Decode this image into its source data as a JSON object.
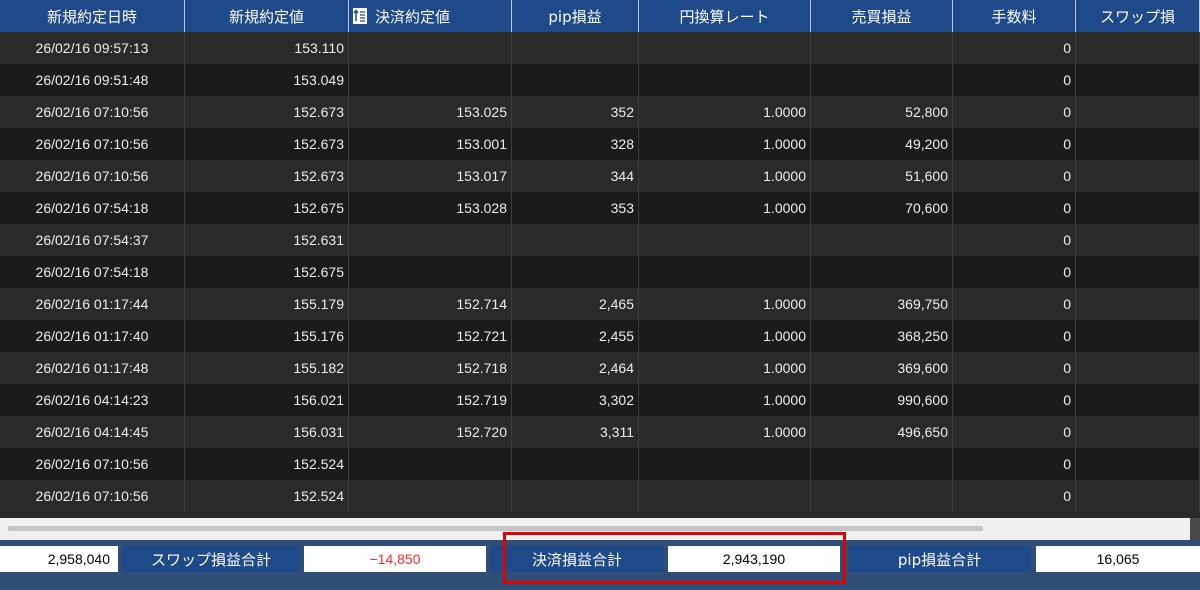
{
  "columns": [
    "新規約定日時",
    "新規約定値",
    "決済約定値",
    "pip損益",
    "円換算レート",
    "売買損益",
    "手数料",
    "スワップ損"
  ],
  "rows": [
    [
      "26/02/16 09:57:13",
      "153.110",
      "",
      "",
      "",
      "",
      "0",
      ""
    ],
    [
      "26/02/16 09:51:48",
      "153.049",
      "",
      "",
      "",
      "",
      "0",
      ""
    ],
    [
      "26/02/16 07:10:56",
      "152.673",
      "153.025",
      "352",
      "1.0000",
      "52,800",
      "0",
      ""
    ],
    [
      "26/02/16 07:10:56",
      "152.673",
      "153.001",
      "328",
      "1.0000",
      "49,200",
      "0",
      ""
    ],
    [
      "26/02/16 07:10:56",
      "152.673",
      "153.017",
      "344",
      "1.0000",
      "51,600",
      "0",
      ""
    ],
    [
      "26/02/16 07:54:18",
      "152.675",
      "153.028",
      "353",
      "1.0000",
      "70,600",
      "0",
      ""
    ],
    [
      "26/02/16 07:54:37",
      "152.631",
      "",
      "",
      "",
      "",
      "0",
      ""
    ],
    [
      "26/02/16 07:54:18",
      "152.675",
      "",
      "",
      "",
      "",
      "0",
      ""
    ],
    [
      "26/02/16 01:17:44",
      "155.179",
      "152.714",
      "2,465",
      "1.0000",
      "369,750",
      "0",
      ""
    ],
    [
      "26/02/16 01:17:40",
      "155.176",
      "152.721",
      "2,455",
      "1.0000",
      "368,250",
      "0",
      ""
    ],
    [
      "26/02/16 01:17:48",
      "155.182",
      "152.718",
      "2,464",
      "1.0000",
      "369,600",
      "0",
      ""
    ],
    [
      "26/02/16 04:14:23",
      "156.021",
      "152.719",
      "3,302",
      "1.0000",
      "990,600",
      "0",
      ""
    ],
    [
      "26/02/16 04:14:45",
      "156.031",
      "152.720",
      "3,311",
      "1.0000",
      "496,650",
      "0",
      ""
    ],
    [
      "26/02/16 07:10:56",
      "152.524",
      "",
      "",
      "",
      "",
      "0",
      ""
    ],
    [
      "26/02/16 07:10:56",
      "152.524",
      "",
      "",
      "",
      "",
      "0",
      ""
    ]
  ],
  "footer": {
    "first_value": "2,958,040",
    "swap_label": "スワップ損益合計",
    "swap_value": "−14,850",
    "settle_label": "決済損益合計",
    "settle_value": "2,943,190",
    "pip_label": "pip損益合計",
    "pip_value": "16,065"
  },
  "icons": {
    "sort": "sort-arrows-icon"
  },
  "colors": {
    "header": "#1e4a8a",
    "negative": "#ff2a2a",
    "highlight": "#e00000",
    "footer": "#2f4f78"
  }
}
